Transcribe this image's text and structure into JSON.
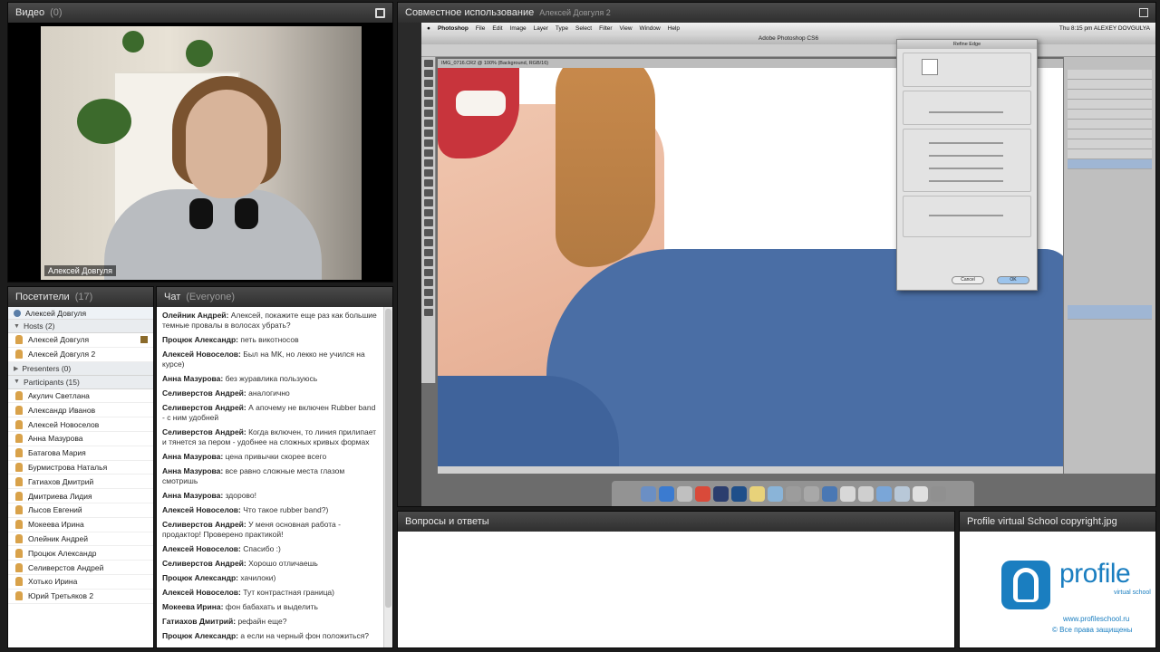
{
  "video": {
    "title": "Видео",
    "count": "(0)",
    "presenter_name": "Алексей Довгуля"
  },
  "attendees": {
    "title": "Посетители",
    "count": "(17)",
    "self": "Алексей Довгуля",
    "groups": {
      "hosts": "Hosts (2)",
      "presenters": "Presenters (0)",
      "participants": "Participants (15)"
    },
    "hosts": [
      "Алексей Довгуля",
      "Алексей Довгуля 2"
    ],
    "participants": [
      "Акулич Светлана",
      "Александр Иванов",
      "Алексей Новоселов",
      "Анна Мазурова",
      "Батагова Мария",
      "Бурмистрова Наталья",
      "Гатиахов Дмитрий",
      "Дмитриева Лидия",
      "Лысов Евгений",
      "Мокеева Ирина",
      "Олейник Андрей",
      "Процюк Александр",
      "Селиверстов Андрей",
      "Хотько Ирина",
      "Юрий Третьяков 2"
    ]
  },
  "chat": {
    "title": "Чат",
    "scope": "(Everyone)",
    "messages": [
      {
        "author": "Олейник Андрей:",
        "text": "Алексей, покажите еще раз как большие темные провалы в волосах убрать?"
      },
      {
        "author": "Процюк Александр:",
        "text": "петь викотносов"
      },
      {
        "author": "Алексей Новоселов:",
        "text": "Был на МК, но лекко не учился на курсе)"
      },
      {
        "author": "Анна Мазурова:",
        "text": "без журавлика пользуюсь"
      },
      {
        "author": "Селиверстов Андрей:",
        "text": "аналогично"
      },
      {
        "author": "Селиверстов Андрей:",
        "text": "А апочему не включен Rubber band - с ним удобней"
      },
      {
        "author": "Селиверстов Андрей:",
        "text": "Когда включен, то линия прилипает и тянется за пером - удобнее на сложных кривых формах"
      },
      {
        "author": "Анна Мазурова:",
        "text": "цена привычки скорее всего"
      },
      {
        "author": "Анна Мазурова:",
        "text": "все равно сложные места глазом смотришь"
      },
      {
        "author": "Анна Мазурова:",
        "text": "здорово!"
      },
      {
        "author": "Алексей Новоселов:",
        "text": "Что такое rubber band?)"
      },
      {
        "author": "Селиверстов Андрей:",
        "text": "У меня основная работа - продактор! Проверено практикой!"
      },
      {
        "author": "Алексей Новоселов:",
        "text": "Спасибо :)"
      },
      {
        "author": "Селиверстов Андрей:",
        "text": "Хорошо отличаешь"
      },
      {
        "author": "Процюк Александр:",
        "text": "хачилоки)"
      },
      {
        "author": "Алексей Новоселов:",
        "text": "Тут контрастная граница)"
      },
      {
        "author": "Мокеева Ирина:",
        "text": "фон бабахать и выделить"
      },
      {
        "author": "Гатиахов Дмитрий:",
        "text": "рефайн еще?"
      },
      {
        "author": "Процюк Александр:",
        "text": "а если на черный фон положиться?"
      }
    ]
  },
  "share": {
    "title": "Совместное использование",
    "presenter": "Алексей Довгуля 2",
    "mac_menu": [
      "Photoshop",
      "File",
      "Edit",
      "Image",
      "Layer",
      "Type",
      "Select",
      "Filter",
      "View",
      "Window",
      "Help"
    ],
    "mac_status": "Thu 8:15 pm  ALEXEY DOVGULYA",
    "ps_title": "Adobe Photoshop CS6",
    "doc_tab": "IMG_0716.CR2 @ 100% (Background, RGB/16)",
    "dialog": {
      "title": "Refine Edge",
      "ok": "OK",
      "cancel": "Cancel"
    }
  },
  "qa": {
    "title": "Вопросы и ответы"
  },
  "note": {
    "title": "Profile virtual School copyright.jpg",
    "brand": "profile",
    "sub": "virtual school",
    "url": "www.profileschool.ru",
    "rights": "© Все права защищены"
  },
  "colors": {
    "brand_blue": "#1a7ec0",
    "pod_header": "#3a3a3a",
    "shirt_blue": "#4a6ea5"
  }
}
